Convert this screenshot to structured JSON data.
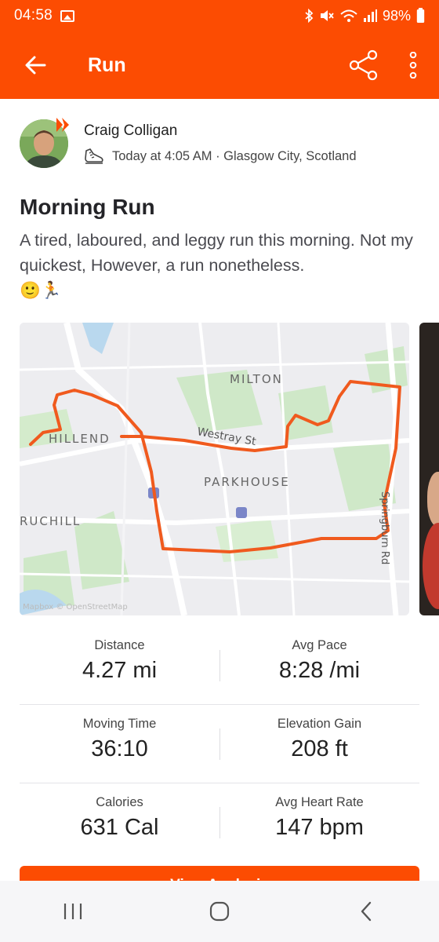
{
  "status_bar": {
    "time": "04:58",
    "battery": "98%",
    "icons": [
      "gallery-icon",
      "bluetooth-icon",
      "mute-icon",
      "wifi-icon",
      "signal-icon",
      "battery-icon"
    ]
  },
  "app_bar": {
    "title": "Run",
    "icons": [
      "back-arrow-icon",
      "share-icon",
      "more-vert-icon"
    ]
  },
  "athlete": {
    "name": "Craig Colligan",
    "timestamp": "Today at 4:05 AM · Glasgow City, Scotland",
    "icons": [
      "shoe-icon"
    ]
  },
  "activity": {
    "title": "Morning Run",
    "description": "A tired, laboured, and leggy run this morning. Not my quickest, However, a run nonetheless.",
    "emoji": "🙂🏃"
  },
  "map": {
    "labels": {
      "milton": "MILTON",
      "hillend": "HILLEND",
      "westray": "Westray St",
      "parkhouse": "PARKHOUSE",
      "ruchill": "RUCHILL",
      "springburn": "Springburn Rd"
    },
    "attribution": "Mapbox © OpenStreetMap",
    "route_color": "#f05a1e"
  },
  "stats": [
    [
      {
        "label": "Distance",
        "value": "4.27 mi"
      },
      {
        "label": "Avg Pace",
        "value": "8:28 /mi"
      }
    ],
    [
      {
        "label": "Moving Time",
        "value": "36:10"
      },
      {
        "label": "Elevation Gain",
        "value": "208 ft"
      }
    ],
    [
      {
        "label": "Calories",
        "value": "631 Cal"
      },
      {
        "label": "Avg Heart Rate",
        "value": "147 bpm"
      }
    ]
  ],
  "analysis_button": "View Analysis",
  "nav_bar": {
    "icons": [
      "recents-icon",
      "home-icon",
      "back-icon"
    ]
  },
  "colors": {
    "brand": "#fc4c02"
  }
}
